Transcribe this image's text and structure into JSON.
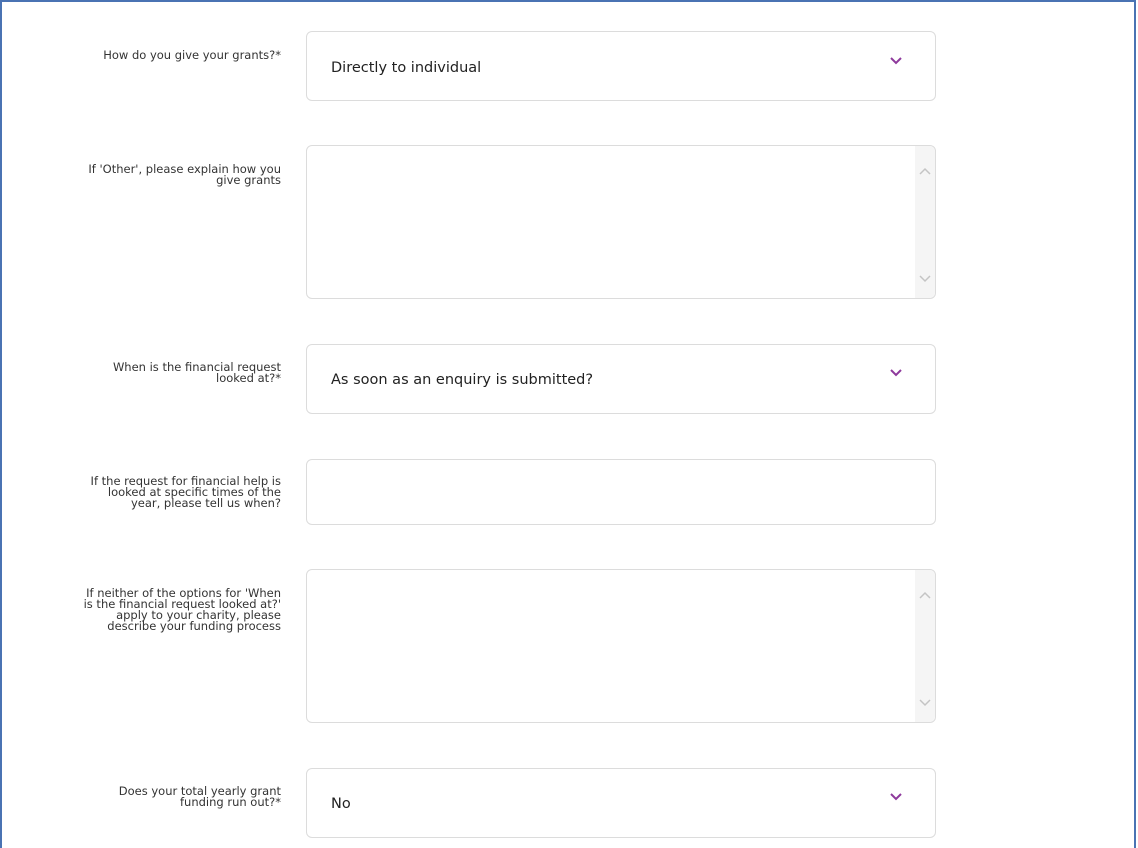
{
  "form": {
    "grants_method": {
      "label": "How do you give your grants?*",
      "value": "Directly to individual",
      "icon": "chevron-down-icon"
    },
    "other_explain": {
      "label_line1": "If 'Other', please explain how you",
      "label_line2": "give grants",
      "value": ""
    },
    "request_timing": {
      "label_line1": "When is the financial request",
      "label_line2": "looked at?*",
      "value": "As soon as an enquiry is submitted?",
      "icon": "chevron-down-icon"
    },
    "specific_times": {
      "label_line1": "If the request for financial help is",
      "label_line2": "looked at specific times of the",
      "label_line3": "year, please tell us when?",
      "value": ""
    },
    "funding_process": {
      "label_line1": "If neither of the options for 'When",
      "label_line2": "is the financial request looked at?'",
      "label_line3": "apply to your charity, please",
      "label_line4": "describe your funding process",
      "value": ""
    },
    "funding_runs_out": {
      "label_line1": "Does your total yearly grant",
      "label_line2": "funding run out?*",
      "value": "No",
      "icon": "chevron-down-icon"
    }
  },
  "colors": {
    "accent": "#8e3a9c",
    "frame": "#4a73b3",
    "border": "#dcdcdc"
  }
}
